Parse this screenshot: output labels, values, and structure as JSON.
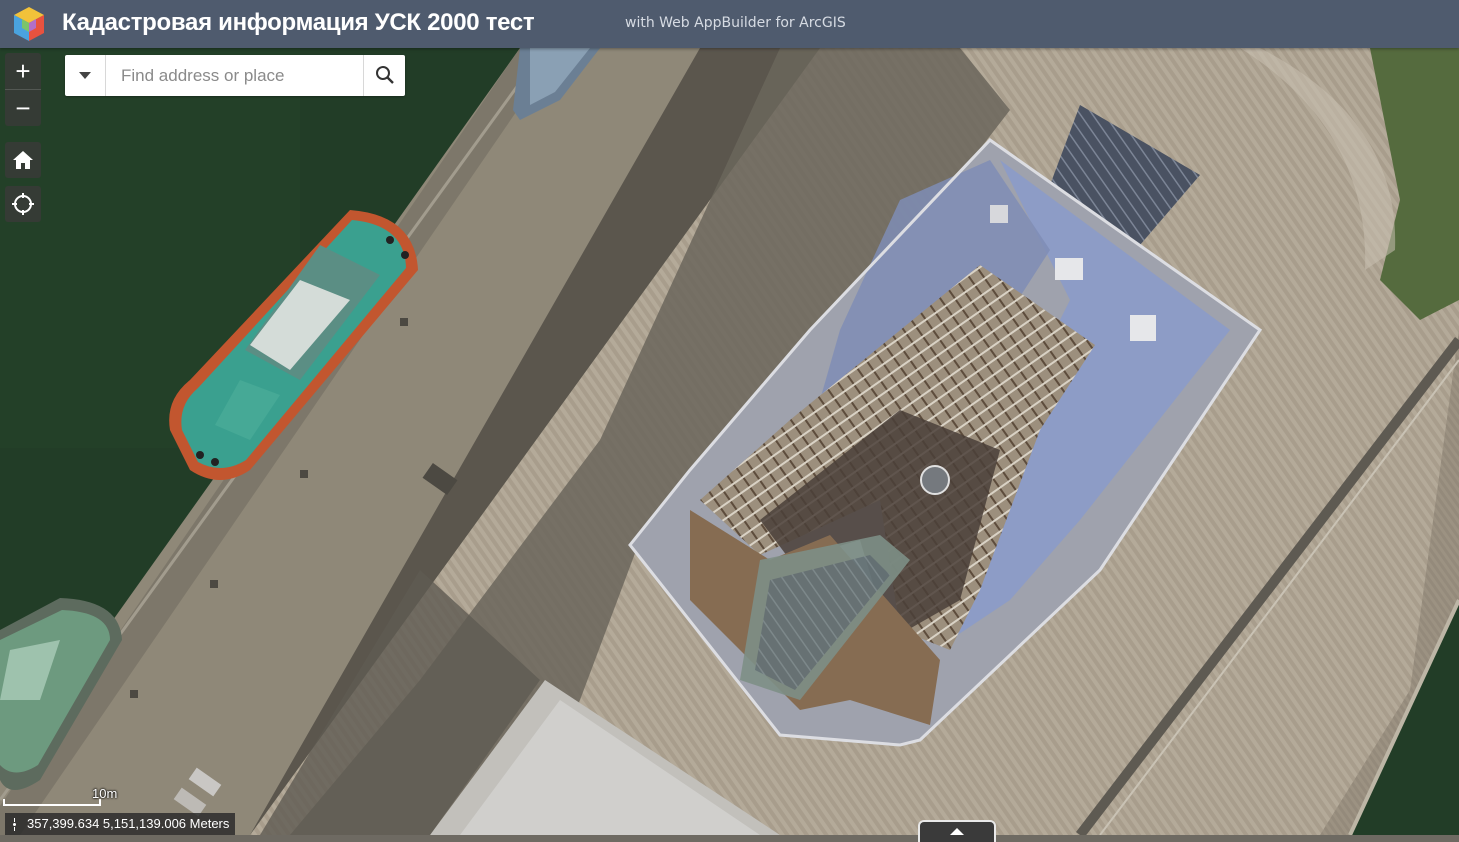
{
  "header": {
    "title": "Кадастровая информация УСК 2000 тест",
    "subtitle": "with Web AppBuilder for ArcGIS"
  },
  "zoom": {
    "in_label": "+",
    "out_label": "−"
  },
  "nav": {
    "home_icon": "home-icon",
    "locate_icon": "locate-icon"
  },
  "search": {
    "placeholder": "Find address or place",
    "value": "",
    "source_icon": "caret-down-icon",
    "submit_icon": "search-icon"
  },
  "scalebar": {
    "label": "10m"
  },
  "coordinates": {
    "text": "357,399.634 5,151,139.006 Meters"
  },
  "colors": {
    "header_bg": "#4f5b6e",
    "water": "#223d27",
    "pier": "#8a8478",
    "tug_deck": "#3aa08f",
    "tug_hull": "#c2562f",
    "roof_blue": "#8d9cc6"
  }
}
